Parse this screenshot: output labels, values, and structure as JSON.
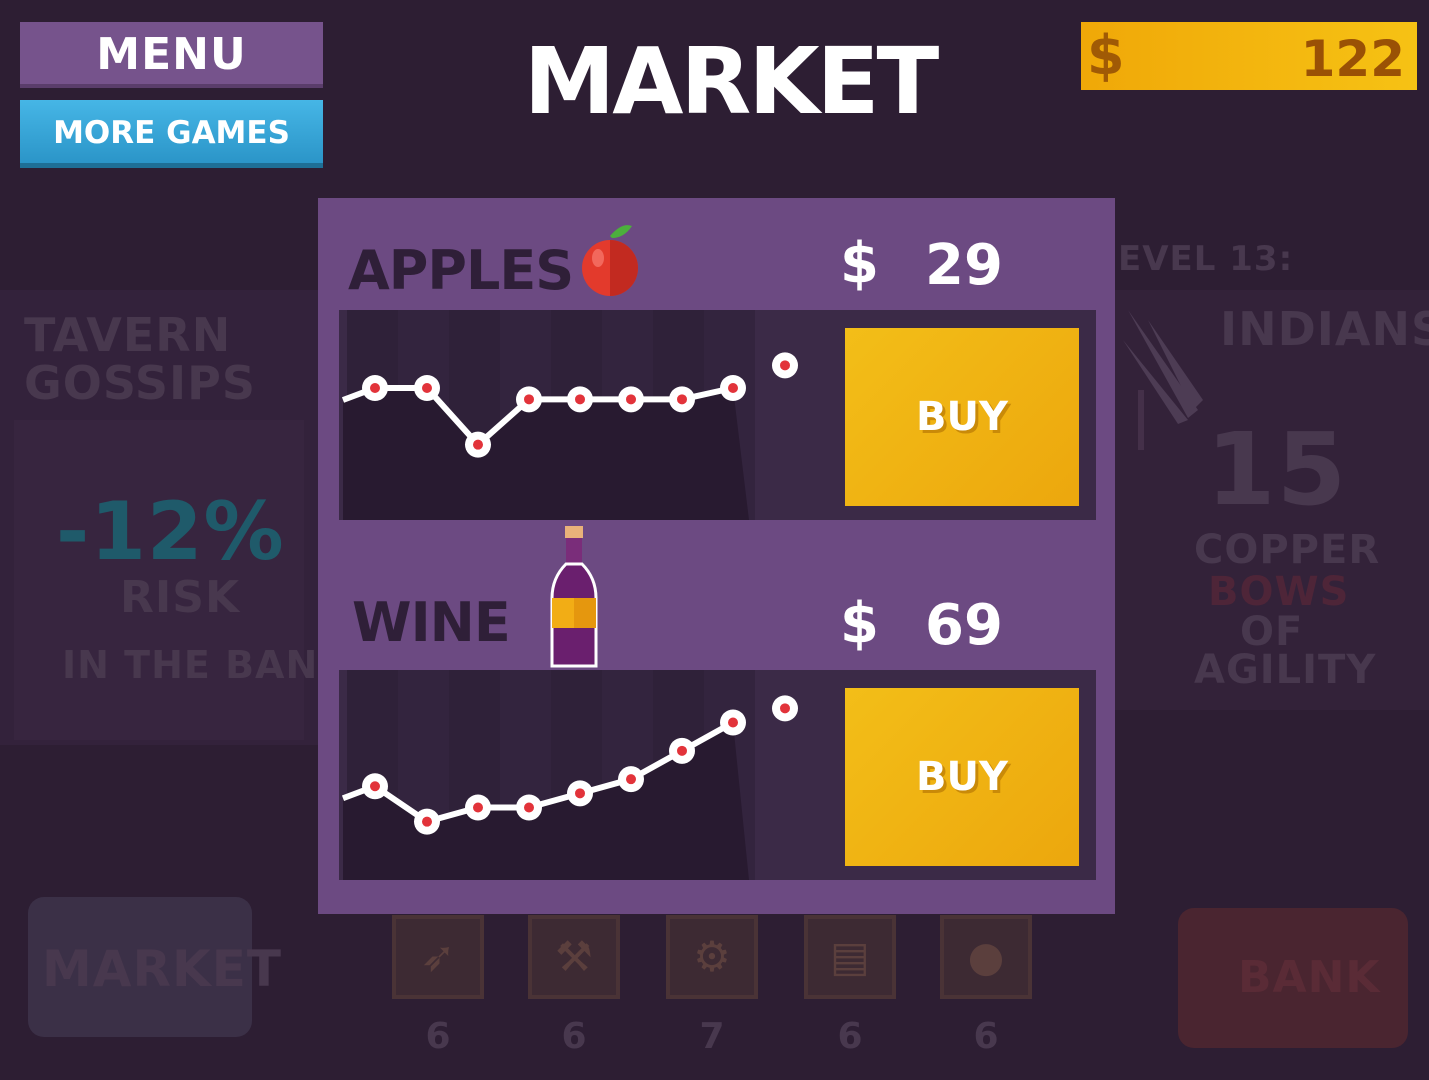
{
  "header": {
    "menu_label": "MENU",
    "more_games_label": "MORE GAMES",
    "title": "MARKET",
    "currency_symbol": "$",
    "balance": "122"
  },
  "background": {
    "left": {
      "heading_line1": "TAVERN",
      "heading_line2": "GOSSIPS",
      "percent": "-12%",
      "risk": "RISK",
      "subtext": "IN THE BANK"
    },
    "right": {
      "level": "EVEL 13:",
      "enemy": "INDIANS",
      "count": "15",
      "line1": "COPPER",
      "line2": "BOWS",
      "line3": "OF",
      "line4": "AGILITY"
    },
    "market_button": "MARKET",
    "bank_button": "BANK",
    "tools": [
      {
        "icon": "cursor-icon",
        "count": "6"
      },
      {
        "icon": "hammer-icon",
        "count": "6"
      },
      {
        "icon": "anvil-icon",
        "count": "7"
      },
      {
        "icon": "book-icon",
        "count": "6"
      },
      {
        "icon": "shield-icon",
        "count": "6"
      }
    ]
  },
  "products": [
    {
      "name": "APPLES",
      "icon": "apple-icon",
      "currency": "$",
      "price": "29",
      "buy_label": "BUY",
      "history": [
        31,
        31,
        26,
        30,
        30,
        30,
        30,
        31,
        33
      ]
    },
    {
      "name": "WINE",
      "icon": "wine-bottle-icon",
      "currency": "$",
      "price": "69",
      "buy_label": "BUY",
      "history": [
        60,
        55,
        57,
        57,
        59,
        61,
        65,
        69,
        71
      ]
    }
  ],
  "colors": {
    "background": "#2d1e33",
    "modal": "#6c4a82",
    "chart_bg": "#3b2a47",
    "buy_button": "#f3be18",
    "more_games": "#39a8da",
    "coins": "#f3b410",
    "point_fill": "#e2333a"
  }
}
